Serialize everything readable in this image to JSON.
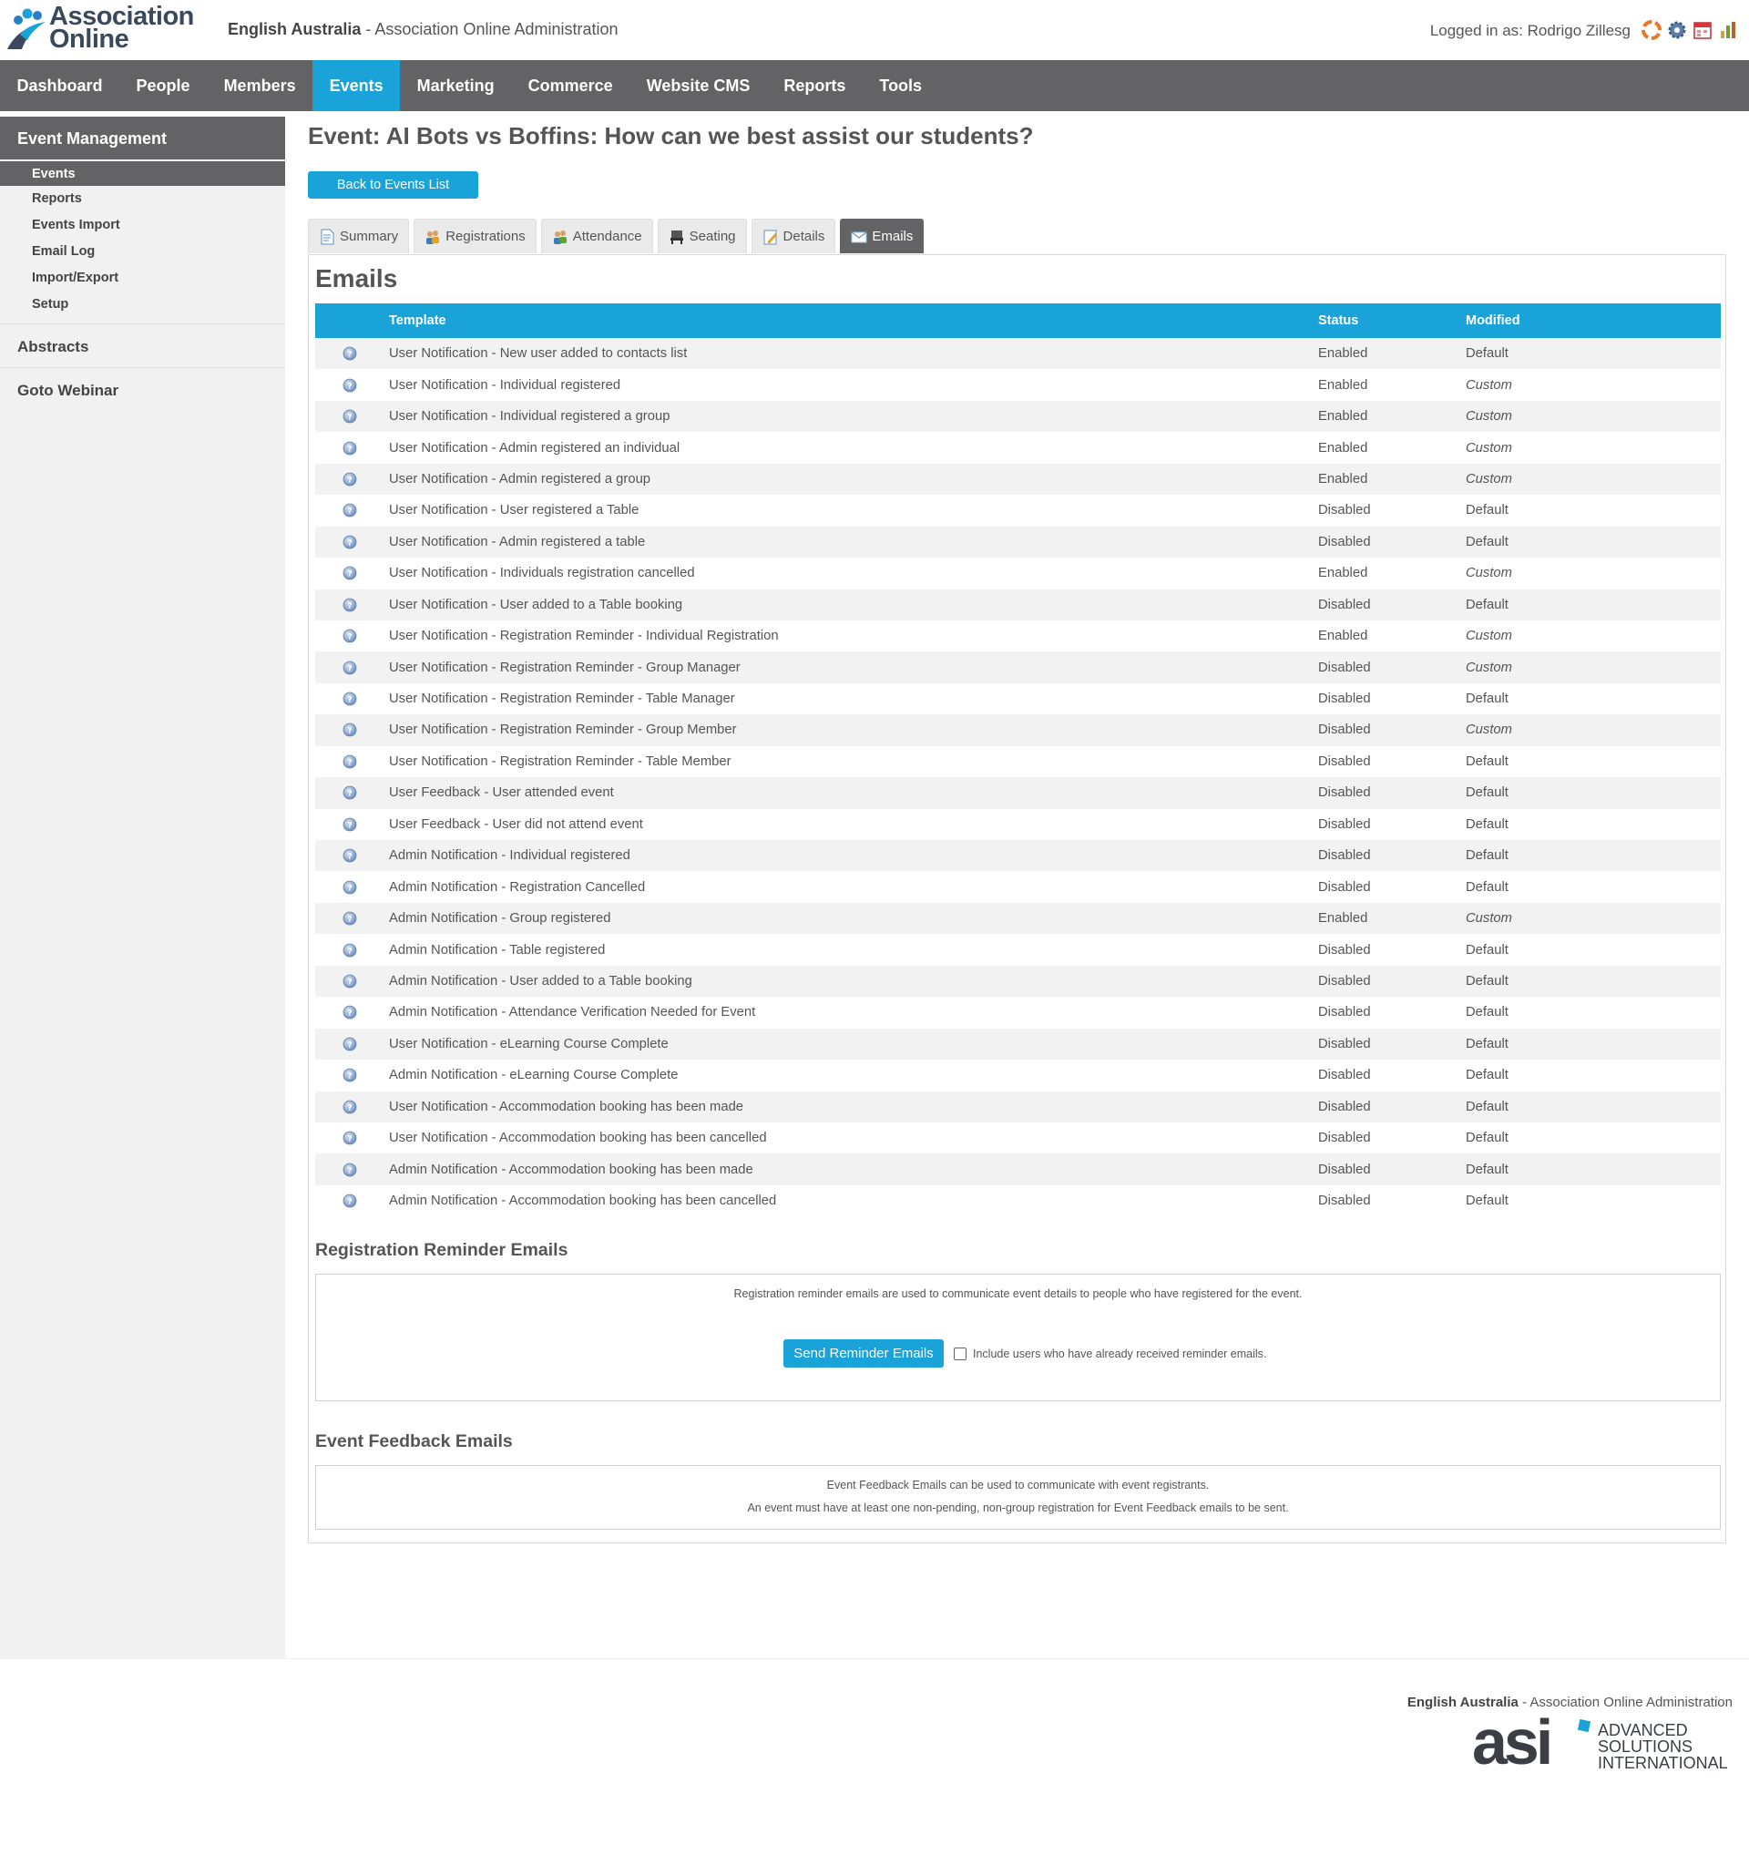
{
  "header": {
    "logo_line1": "Association",
    "logo_line2": "Online",
    "org": "English Australia",
    "separator": " - ",
    "app_name": "Association Online Administration",
    "logged_in": "Logged in as: Rodrigo Zillesg",
    "icons": [
      "help-lifebuoy-icon",
      "settings-gear-icon",
      "calendar-icon",
      "reports-icon"
    ]
  },
  "nav": {
    "items": [
      "Dashboard",
      "People",
      "Members",
      "Events",
      "Marketing",
      "Commerce",
      "Website CMS",
      "Reports",
      "Tools"
    ],
    "active": "Events"
  },
  "sidebar": {
    "heading": "Event Management",
    "items": [
      "Events",
      "Reports",
      "Events Import",
      "Email Log",
      "Import/Export",
      "Setup"
    ],
    "active": "Events",
    "sections": [
      "Abstracts",
      "Goto Webinar"
    ]
  },
  "main": {
    "title": "Event: AI Bots vs Boffins: How can we best assist our students?",
    "back_button": "Back to Events List",
    "tabs": [
      {
        "label": "Summary",
        "icon": "document-icon"
      },
      {
        "label": "Registrations",
        "icon": "users-icon"
      },
      {
        "label": "Attendance",
        "icon": "users-check-icon"
      },
      {
        "label": "Seating",
        "icon": "seat-icon"
      },
      {
        "label": "Details",
        "icon": "edit-icon"
      },
      {
        "label": "Emails",
        "icon": "envelope-icon"
      }
    ],
    "active_tab": "Emails",
    "emails_heading": "Emails",
    "table": {
      "headers": [
        "Template",
        "Status",
        "Modified"
      ],
      "rows": [
        {
          "template": "User Notification - New user added to contacts list",
          "status": "Enabled",
          "modified": "Default"
        },
        {
          "template": "User Notification - Individual registered",
          "status": "Enabled",
          "modified": "Custom"
        },
        {
          "template": "User Notification - Individual registered a group",
          "status": "Enabled",
          "modified": "Custom"
        },
        {
          "template": "User Notification - Admin registered an individual",
          "status": "Enabled",
          "modified": "Custom"
        },
        {
          "template": "User Notification - Admin registered a group",
          "status": "Enabled",
          "modified": "Custom"
        },
        {
          "template": "User Notification - User registered a Table",
          "status": "Disabled",
          "modified": "Default"
        },
        {
          "template": "User Notification - Admin registered a table",
          "status": "Disabled",
          "modified": "Default"
        },
        {
          "template": "User Notification - Individuals registration cancelled",
          "status": "Enabled",
          "modified": "Custom"
        },
        {
          "template": "User Notification - User added to a Table booking",
          "status": "Disabled",
          "modified": "Default"
        },
        {
          "template": "User Notification - Registration Reminder - Individual Registration",
          "status": "Enabled",
          "modified": "Custom"
        },
        {
          "template": "User Notification - Registration Reminder - Group Manager",
          "status": "Disabled",
          "modified": "Custom"
        },
        {
          "template": "User Notification - Registration Reminder - Table Manager",
          "status": "Disabled",
          "modified": "Default"
        },
        {
          "template": "User Notification - Registration Reminder - Group Member",
          "status": "Disabled",
          "modified": "Custom"
        },
        {
          "template": "User Notification - Registration Reminder - Table Member",
          "status": "Disabled",
          "modified": "Default"
        },
        {
          "template": "User Feedback - User attended event",
          "status": "Disabled",
          "modified": "Default"
        },
        {
          "template": "User Feedback - User did not attend event",
          "status": "Disabled",
          "modified": "Default"
        },
        {
          "template": "Admin Notification - Individual registered",
          "status": "Disabled",
          "modified": "Default"
        },
        {
          "template": "Admin Notification - Registration Cancelled",
          "status": "Disabled",
          "modified": "Default"
        },
        {
          "template": "Admin Notification - Group registered",
          "status": "Enabled",
          "modified": "Custom"
        },
        {
          "template": "Admin Notification - Table registered",
          "status": "Disabled",
          "modified": "Default"
        },
        {
          "template": "Admin Notification - User added to a Table booking",
          "status": "Disabled",
          "modified": "Default"
        },
        {
          "template": "Admin Notification - Attendance Verification Needed for Event",
          "status": "Disabled",
          "modified": "Default"
        },
        {
          "template": "User Notification - eLearning Course Complete",
          "status": "Disabled",
          "modified": "Default"
        },
        {
          "template": "Admin Notification - eLearning Course Complete",
          "status": "Disabled",
          "modified": "Default"
        },
        {
          "template": "User Notification - Accommodation booking has been made",
          "status": "Disabled",
          "modified": "Default"
        },
        {
          "template": "User Notification - Accommodation booking has been cancelled",
          "status": "Disabled",
          "modified": "Default"
        },
        {
          "template": "Admin Notification - Accommodation booking has been made",
          "status": "Disabled",
          "modified": "Default"
        },
        {
          "template": "Admin Notification - Accommodation booking has been cancelled",
          "status": "Disabled",
          "modified": "Default"
        }
      ]
    },
    "reminder": {
      "heading": "Registration Reminder Emails",
      "description": "Registration reminder emails are used to communicate event details to people who have registered for the event.",
      "button": "Send Reminder Emails",
      "checkbox_label": "Include users who have already received reminder emails.",
      "checkbox_checked": false
    },
    "feedback": {
      "heading": "Event Feedback Emails",
      "line1": "Event Feedback Emails can be used to communicate with event registrants.",
      "line2": "An event must have at least one non-pending, non-group registration for Event Feedback emails to be sent."
    }
  },
  "footer": {
    "org": "English Australia",
    "separator": " - ",
    "app_name": "Association Online Administration",
    "logo_mark": "asi",
    "logo_line1": "ADVANCED",
    "logo_line2": "SOLUTIONS",
    "logo_line3": "INTERNATIONAL"
  },
  "colors": {
    "accent": "#1aa3d9",
    "nav_bg": "#636366",
    "enabled": "#1f8c1f",
    "disabled": "#e0001b"
  }
}
